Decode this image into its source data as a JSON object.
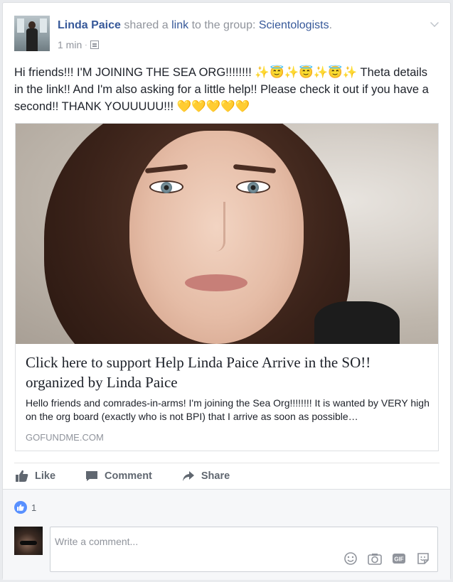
{
  "post": {
    "author": "Linda Paice",
    "shared_text": "shared a",
    "link_word": "link",
    "to_group_text": "to the group:",
    "group": "Scientologists",
    "period": ".",
    "time": "1 min",
    "dot": "·",
    "body": "Hi friends!!! I'M JOINING THE SEA ORG!!!!!!!! ✨😇✨😇✨😇✨ Theta details in the link!! And I'm also asking for a little help!! Please check it out if you have a second!! THANK YOUUUUU!!! 💛💛💛💛💛"
  },
  "link_preview": {
    "title": "Click here to support Help Linda Paice Arrive in the SO!! organized by Linda Paice",
    "description": "Hello friends and comrades-in-arms! I'm joining the Sea Org!!!!!!!! It is wanted by VERY high on the org board (exactly who is not BPI) that I arrive as soon as possible…",
    "domain": "GOFUNDME.COM"
  },
  "actions": {
    "like": "Like",
    "comment": "Comment",
    "share": "Share"
  },
  "reactions": {
    "count": "1"
  },
  "comment_box": {
    "placeholder": "Write a comment..."
  },
  "colors": {
    "link": "#365899",
    "meta": "#90949c",
    "like_badge": "#5890ff"
  }
}
